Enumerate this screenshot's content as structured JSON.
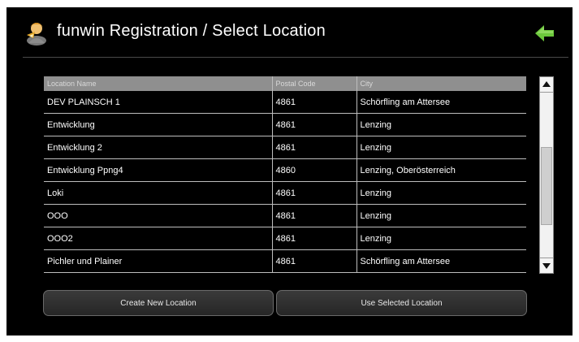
{
  "header": {
    "title": "funwin Registration / Select Location",
    "back_icon": "arrow-left-icon",
    "logo_icon": "user-logo-icon",
    "accent": "#6cc83c"
  },
  "table": {
    "columns": [
      "Location Name",
      "Postal Code",
      "City"
    ],
    "rows": [
      [
        "DEV PLAINSCH 1",
        "4861",
        "Schörfling am Attersee"
      ],
      [
        "Entwicklung",
        "4861",
        "Lenzing"
      ],
      [
        "Entwicklung 2",
        "4861",
        "Lenzing"
      ],
      [
        "Entwicklung Ppng4",
        "4860",
        "Lenzing, Oberösterreich"
      ],
      [
        "Loki",
        "4861",
        "Lenzing"
      ],
      [
        "OOO",
        "4861",
        "Lenzing"
      ],
      [
        "OOO2",
        "4861",
        "Lenzing"
      ],
      [
        "Pichler und Plainer",
        "4861",
        "Schörfling am Attersee"
      ]
    ]
  },
  "buttons": {
    "create": "Create New Location",
    "use": "Use Selected Location"
  }
}
